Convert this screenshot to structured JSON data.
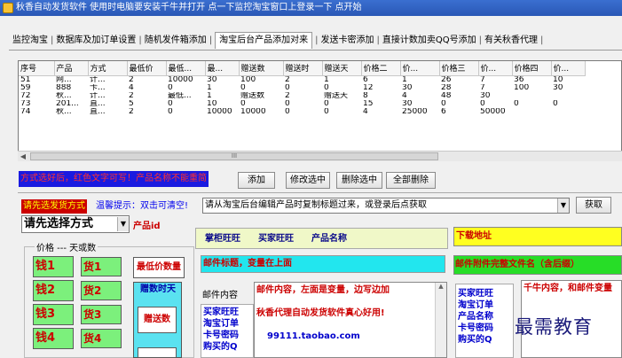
{
  "window": {
    "title": "秋香自动发货软件 使用时电脑要安装千牛并打开 点一下监控淘宝窗口上登录一下 点开始"
  },
  "tabs": [
    {
      "label": "监控淘宝"
    },
    {
      "label": "数据库及加订单设置"
    },
    {
      "label": "随机发件箱添加"
    },
    {
      "label": "淘宝后台产品添加对来"
    },
    {
      "label": "发送卡密添加"
    },
    {
      "label": "直接计数加卖QQ号添加"
    },
    {
      "label": "有关秋香代理"
    }
  ],
  "grid": {
    "columns": [
      "序号",
      "产品",
      "方式",
      "最低价",
      "最低...",
      "最...",
      "赠送数",
      "赠送时",
      "赠送天",
      "价格二",
      "价...",
      "价格三",
      "价...",
      "价格四",
      "价..."
    ],
    "rows": [
      [
        "51",
        "网...",
        "计...",
        "2",
        "10000",
        "30",
        "100",
        "2",
        "1",
        "6",
        "1",
        "26",
        "7",
        "36",
        "10"
      ],
      [
        "59",
        "888",
        "卡...",
        "4",
        "0",
        "1",
        "0",
        "0",
        "0",
        "12",
        "30",
        "28",
        "7",
        "100",
        "30"
      ],
      [
        "72",
        "秋...",
        "计...",
        "2",
        "最低...",
        "1",
        "赠送数",
        "2",
        "赠送天",
        "8",
        "4",
        "48",
        "30",
        "",
        ""
      ],
      [
        "73",
        "201...",
        "直...",
        "5",
        "0",
        "10",
        "0",
        "0",
        "0",
        "15",
        "30",
        "0",
        "0",
        "0",
        "0"
      ],
      [
        "74",
        "秋...",
        "直...",
        "2",
        "0",
        "10000",
        "10000",
        "0",
        "0",
        "4",
        "25000",
        "6",
        "50000",
        "",
        ""
      ]
    ],
    "scroll_thumb": "III"
  },
  "hint_red": "方式选好后，红色文字可写！产品名称不能重简",
  "buttons": {
    "add": "添加",
    "modify": "修改选中",
    "delete_selected": "删除选中",
    "delete_all": "全部删除",
    "fetch": "获取"
  },
  "send_mode_label": "请先选发货方式",
  "tip": "温馨提示：双击可清空!",
  "title_combo": "请从淘宝后台编辑产品时复制标题过来，或登录后点获取",
  "mode_select": "请先选择方式",
  "product_id_label": "产品id",
  "price_group": {
    "legend": "价格 --- 天或数",
    "price_buttons": [
      "钱1",
      "钱2",
      "钱3",
      "钱4"
    ],
    "goods_buttons": [
      "货1",
      "货2",
      "货3",
      "货4"
    ],
    "min_price_qty": "最低价数量",
    "gift_days": "赠数时天",
    "gift_count": "赠送数"
  },
  "shopkeeper": {
    "labels": [
      "掌柜旺旺",
      "买家旺旺",
      "产品名称"
    ]
  },
  "mail_title": "邮件标题，变量在上面",
  "mail_content_label": "邮件内容",
  "mail_side": [
    "买家旺旺",
    "淘宝订单",
    "卡号密码",
    "购买的Q"
  ],
  "mail_body": [
    "邮件内容，左面是变量，边写边加",
    "",
    "秋香代理自动发货软件真心好用!",
    "",
    "99111.taobao.com"
  ],
  "download_label": "下载地址",
  "attach_label": "邮件附件完整文件名（含后缀）",
  "thousand_side": [
    "买家旺旺",
    "淘宝订单",
    "产品名称",
    "卡号密码",
    "购买的Q"
  ],
  "thousand_body": "千牛内容，和邮件变量",
  "watermark": "最需教育",
  "icons": {
    "dropdown": "▼",
    "scroll_left": "◀",
    "scroll_up": "▲"
  }
}
